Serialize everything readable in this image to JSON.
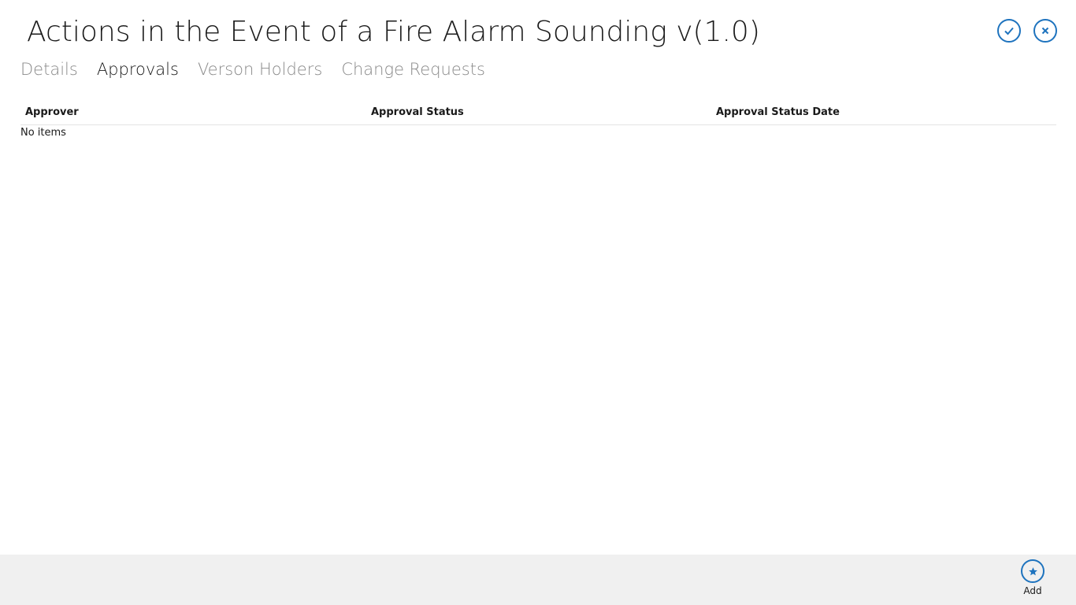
{
  "header": {
    "title": "Actions in the Event of a Fire Alarm Sounding v(1.0)",
    "accent_color": "#1e73be",
    "confirm_icon": "check-icon",
    "close_icon": "close-icon"
  },
  "tabs": [
    {
      "label": "Details",
      "active": false
    },
    {
      "label": "Approvals",
      "active": true
    },
    {
      "label": "Verson Holders",
      "active": false
    },
    {
      "label": "Change Requests",
      "active": false
    }
  ],
  "table": {
    "columns": [
      "Approver",
      "Approval Status",
      "Approval Status Date"
    ],
    "rows": [],
    "empty_text": "No items"
  },
  "appbar": {
    "add_label": "Add",
    "add_icon": "star-icon"
  }
}
